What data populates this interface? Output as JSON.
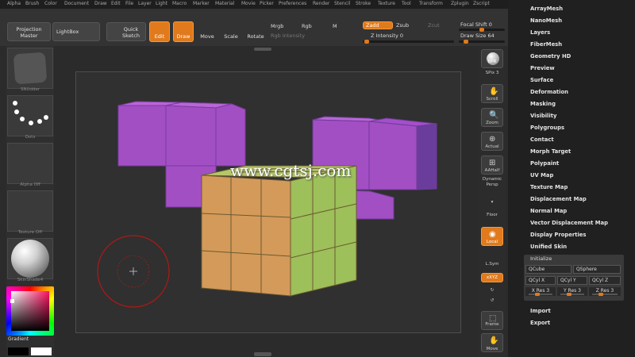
{
  "menu": [
    "Alpha",
    "Brush",
    "Color",
    "Document",
    "Draw",
    "Edit",
    "File",
    "Layer",
    "Light",
    "Macro",
    "Marker",
    "Material",
    "Movie",
    "Picker",
    "Preferences",
    "Render",
    "Stencil",
    "Stroke",
    "Texture",
    "Tool",
    "Transform",
    "Zplugin",
    "Zscript"
  ],
  "toolbar": {
    "projection_master": "Projection Master",
    "lightbox": "LightBox",
    "quick_sketch": "Quick Sketch",
    "edit": "Edit",
    "draw": "Draw",
    "move": "Move",
    "scale": "Scale",
    "rotate": "Rotate",
    "mrgb": "Mrgb",
    "rgb": "Rgb",
    "m": "M",
    "rgb_intensity": "Rgb Intensity",
    "zadd": "Zadd",
    "zsub": "Zsub",
    "zcut": "Zcut",
    "z_intensity": "Z Intensity 0",
    "focal_shift": "Focal Shift 0",
    "draw_size": "Draw Size 64"
  },
  "left": {
    "brush_label": "SNUdder",
    "stroke_label": "Dots",
    "alpha_label": "Alpha Off",
    "texture_label": "Texture Off",
    "material_label": "SkinShade4",
    "gradient": "Gradient"
  },
  "watermark": "www.cgtsj.com",
  "colors": {
    "accent": "#e07a1c",
    "purple_front": "#a34fc4",
    "purple_top": "#b966d6",
    "purple_side": "#6a3d9c",
    "cube_front": "#d49a5a",
    "cube_top": "#b6c66a",
    "cube_side": "#9dc05a"
  },
  "right_shelf": {
    "bpr": "BPR",
    "spix": "SPix 3",
    "scroll": "Scroll",
    "zoom": "Zoom",
    "actual": "Actual",
    "aahalf": "AAHalf",
    "persp": "Dynamic Persp",
    "floor": "Floor",
    "local": "Local",
    "lsym": "L.Sym",
    "xyz": "xXYZ",
    "frame": "Frame",
    "move": "Move"
  },
  "palette": {
    "items": [
      "ArrayMesh",
      "NanoMesh",
      "Layers",
      "FiberMesh",
      "Geometry HD",
      "Preview",
      "Surface",
      "Deformation",
      "Masking",
      "Visibility",
      "Polygroups",
      "Contact",
      "Morph Target",
      "Polypaint",
      "UV Map",
      "Texture Map",
      "Displacement Map",
      "Normal Map",
      "Vector Displacement Map",
      "Display Properties",
      "Unified Skin"
    ],
    "initialize": "Initialize",
    "qcube": "QCube",
    "qsphere": "QSphere",
    "qcyl_x": "QCyl X",
    "qcyl_y": "QCyl Y",
    "qcyl_z": "QCyl Z",
    "xres": "X Res 3",
    "yres": "Y Res 3",
    "zres": "Z Res 3",
    "import": "Import",
    "export": "Export"
  }
}
